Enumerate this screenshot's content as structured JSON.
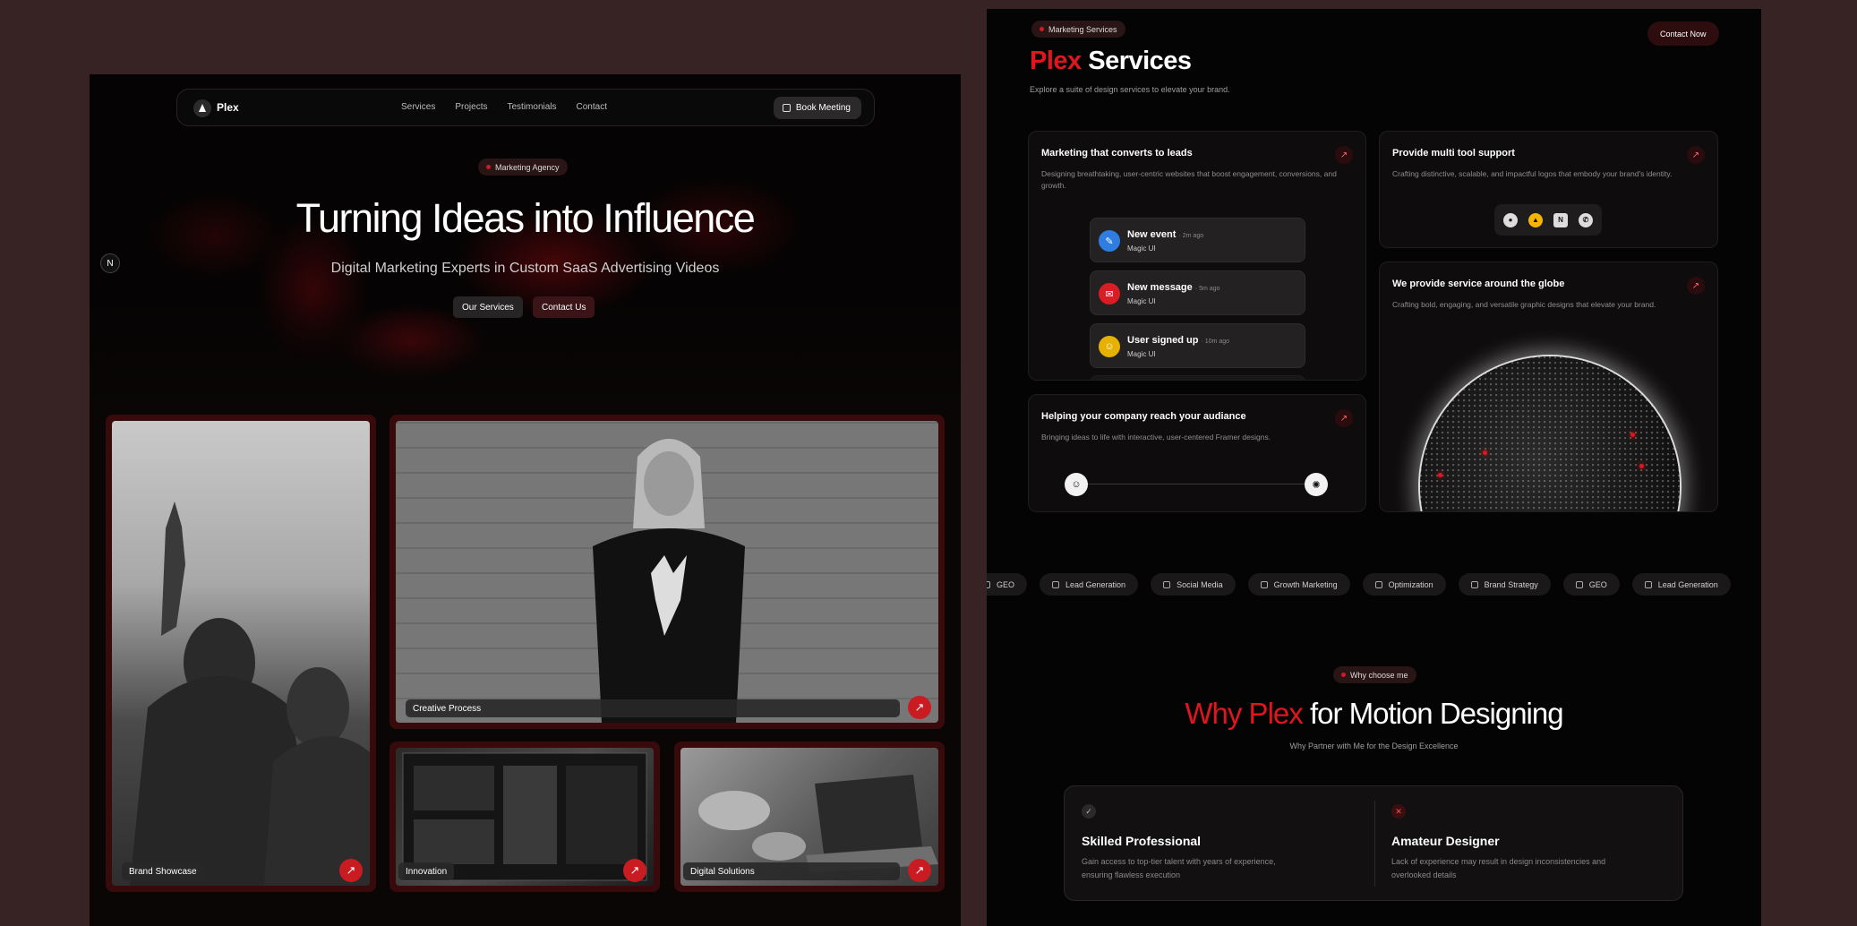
{
  "landing": {
    "brand": "Plex",
    "nav_links": [
      "Services",
      "Projects",
      "Testimonials",
      "Contact"
    ],
    "book_meeting": "Book Meeting",
    "badge": "Marketing Agency",
    "title": "Turning Ideas into Influence",
    "subtitle": "Digital Marketing Experts in Custom SaaS Advertising Videos",
    "btn_services": "Our Services",
    "btn_contact": "Contact Us",
    "n_badge": "N",
    "cards": [
      {
        "label": "Brand Showcase"
      },
      {
        "label": "Creative Process"
      },
      {
        "label": "Innovation"
      },
      {
        "label": "Digital Solutions"
      }
    ],
    "arrow_glyph": "↗"
  },
  "services": {
    "badge": "Marketing Services",
    "contact_now": "Contact Now",
    "title_accent": "Plex",
    "title_rest": "Services",
    "subtitle": "Explore a suite of design services to elevate your brand.",
    "panels": [
      {
        "title": "Marketing that converts to leads",
        "desc": "Designing breathtaking, user-centric websites that boost engagement, conversions, and growth."
      },
      {
        "title": "Provide multi tool support",
        "desc": "Crafting distinctive, scalable, and impactful logos that embody your brand's identity."
      },
      {
        "title": "Helping your company reach your audiance",
        "desc": "Bringing ideas to life with interactive, user-centered Framer designs."
      },
      {
        "title": "We provide service around the globe",
        "desc": "Crafting bold, engaging, and versatile graphic designs that elevate your brand."
      }
    ],
    "notifications": [
      {
        "title": "New event",
        "time": "· 2m ago",
        "source": "Magic UI",
        "icon": "calendar-icon",
        "color": "#2f7de1"
      },
      {
        "title": "New message",
        "time": "· 5m ago",
        "source": "Magic UI",
        "icon": "chat-icon",
        "color": "#d91d25"
      },
      {
        "title": "User signed up",
        "time": "· 10m ago",
        "source": "Magic UI",
        "icon": "user-icon",
        "color": "#e6b100"
      }
    ],
    "tools": [
      "github-icon",
      "google-drive-icon",
      "notion-icon",
      "whatsapp-icon"
    ],
    "ticker": [
      "GEO",
      "Lead Generation",
      "Social Media",
      "Growth Marketing",
      "Optimization",
      "Brand Strategy",
      "GEO",
      "Lead Generation"
    ]
  },
  "why": {
    "badge": "Why choose me",
    "title_accent": "Why Plex",
    "title_rest": "for Motion Designing",
    "subtitle": "Why Partner with Me for the Design Excellence",
    "pro": {
      "title": "Skilled Professional",
      "desc": "Gain access to top-tier talent with years of experience, ensuring flawless execution"
    },
    "amateur": {
      "title": "Amateur Designer",
      "desc": "Lack of experience may result in design inconsistencies and overlooked details"
    }
  },
  "colors": {
    "accent": "#e0151e",
    "background": "#372224"
  }
}
